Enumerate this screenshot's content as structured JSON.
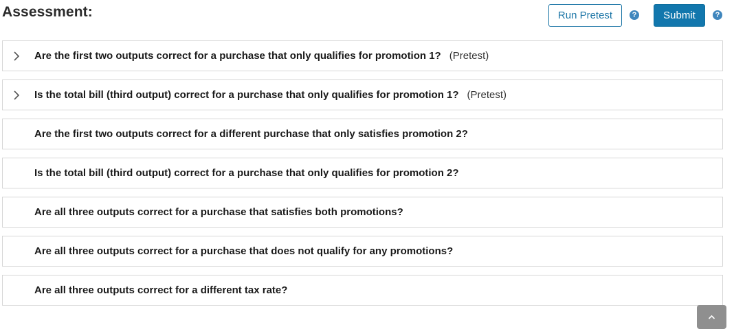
{
  "header": {
    "title": "Assessment:",
    "run_pretest_label": "Run Pretest",
    "submit_label": "Submit",
    "help_icon_glyph": "?"
  },
  "colors": {
    "accent": "#1277ad",
    "help_icon": "#3f86bd",
    "border": "#d6d6d6",
    "scroll_button": "#8f8f8f"
  },
  "items": [
    {
      "question": "Are the first two outputs correct for a purchase that only qualifies for promotion 1?",
      "tag": "(Pretest)",
      "expandable": true,
      "icon": "chevron-right-icon"
    },
    {
      "question": "Is the total bill (third output) correct for a purchase that only qualifies for promotion 1?",
      "tag": "(Pretest)",
      "expandable": true,
      "icon": "chevron-right-icon"
    },
    {
      "question": "Are the first two outputs correct for a different purchase that only satisfies promotion 2?",
      "tag": "",
      "expandable": false
    },
    {
      "question": "Is the total bill (third output) correct for a purchase that only qualifies for promotion 2?",
      "tag": "",
      "expandable": false
    },
    {
      "question": "Are all three outputs correct for a purchase that satisfies both promotions?",
      "tag": "",
      "expandable": false
    },
    {
      "question": "Are all three outputs correct for a purchase that does not qualify for any promotions?",
      "tag": "",
      "expandable": false
    },
    {
      "question": "Are all three outputs correct for a different tax rate?",
      "tag": "",
      "expandable": false
    }
  ],
  "scroll_top_icon": "chevron-up-icon"
}
